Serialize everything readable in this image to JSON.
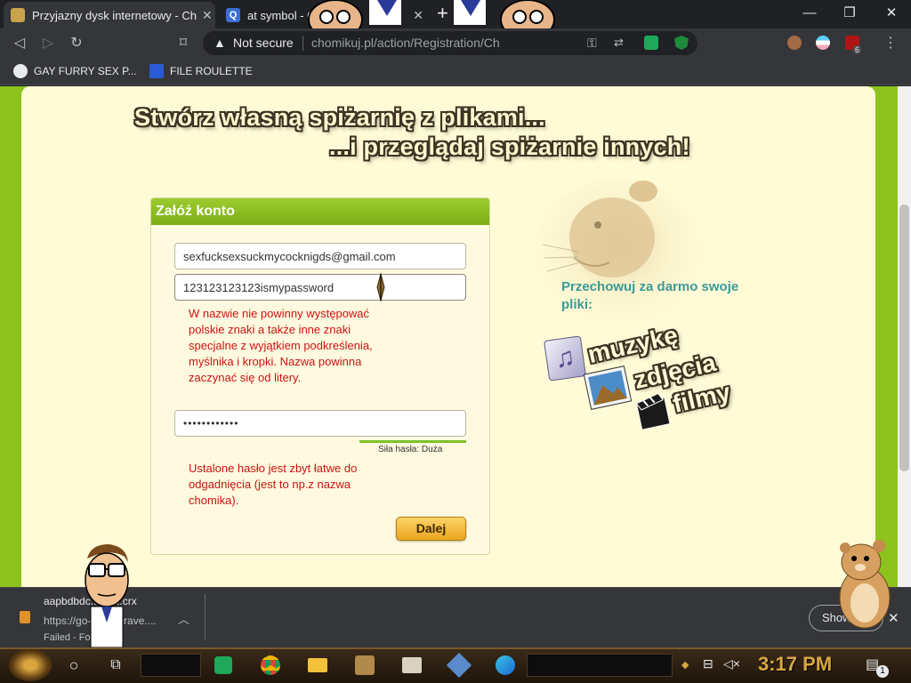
{
  "browser": {
    "tabs": [
      {
        "title": "Przyjazny dysk internetowy - Ch"
      },
      {
        "title": "at symbol - G"
      }
    ],
    "new_tab_glyph": "+",
    "window_controls": {
      "minimize": "—",
      "restore": "❐",
      "close": "✕"
    },
    "omnibox": {
      "security_label": "Not secure",
      "url": "chomikuj.pl/action/Registration/Ch"
    },
    "bookmarks": [
      {
        "label": "GAY FURRY SEX P..."
      },
      {
        "label": "FILE ROULETTE"
      }
    ],
    "extension_badge": "6"
  },
  "page": {
    "headline_line1": "Stwórz własną spiżarnię z plikami...",
    "headline_line2": "...i przeglądaj spiżarnie innych!",
    "form": {
      "title": "Załóż konto",
      "email_value": "sexfucksexsuckmycocknigds@gmail.com",
      "username_value": "123123123123ismypassword",
      "username_error": "W nazwie nie powinny występować polskie znaki a także inne znaki specjalne z wyjątkiem podkreślenia, myślnika i kropki. Nazwa powinna zaczynać się od litery.",
      "password_value": "••••••••••••",
      "strength_label": "Siła hasła: Duża",
      "password_error": "Ustalone hasło jest zbyt łatwe do odgadnięcia (jest to np.z nazwa chomika).",
      "submit_label": "Dalej"
    },
    "side": {
      "title": "Przechowuj za darmo swoje pliki:",
      "items": [
        "muzykę",
        "zdjęcia",
        "filmy"
      ]
    }
  },
  "download": {
    "filename": "aapbdbdc...ka....crx",
    "url": "https://go-...der.brave....",
    "status": "Failed - Forb",
    "show_all_label": "Show",
    "close_glyph": "✕"
  },
  "taskbar": {
    "clock": "3:17 PM",
    "notification_count": "1"
  },
  "colors": {
    "page_green": "#8dc21f",
    "cream": "#fffbd6",
    "error_red": "#cc1111",
    "teal_text": "#3a9a9a",
    "button_orange": "#e9a51f"
  }
}
